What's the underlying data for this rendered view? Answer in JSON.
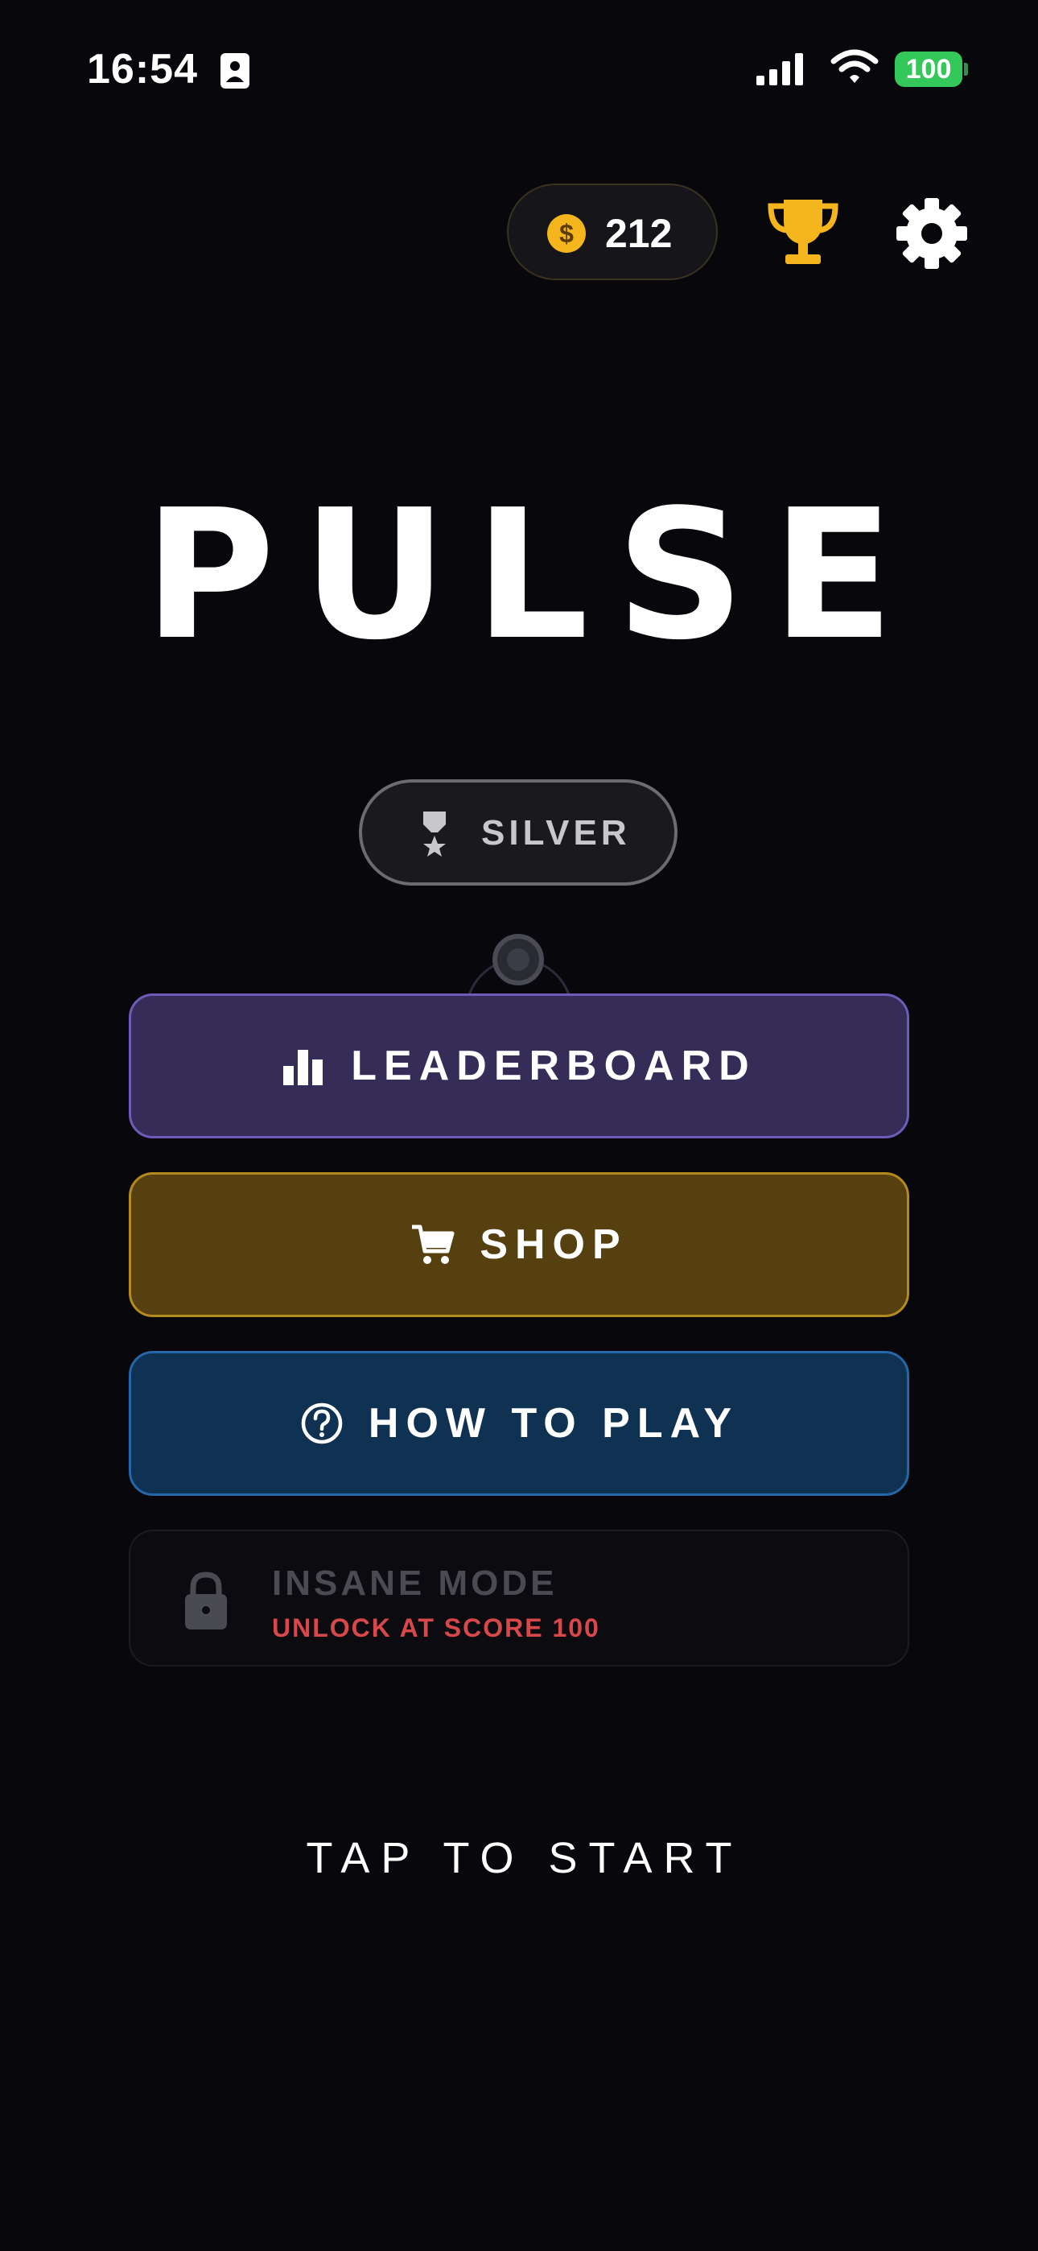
{
  "status_bar": {
    "time": "16:54",
    "battery": "100",
    "icons": [
      "contact-card-icon",
      "signal-icon",
      "wifi-icon",
      "battery-icon"
    ]
  },
  "top_bar": {
    "coins": "212",
    "coin_icon": "dollar-coin-icon",
    "trophy_icon": "trophy-icon",
    "settings_icon": "gear-icon"
  },
  "title": "PULSE",
  "rank": {
    "label": "SILVER",
    "icon": "medal-icon"
  },
  "menu": {
    "leaderboard": {
      "label": "LEADERBOARD",
      "icon": "bar-chart-icon"
    },
    "shop": {
      "label": "SHOP",
      "icon": "cart-icon"
    },
    "how_to_play": {
      "label": "HOW TO PLAY",
      "icon": "help-circle-icon"
    }
  },
  "locked_mode": {
    "title": "INSANE MODE",
    "subtitle": "UNLOCK AT SCORE 100",
    "icon": "lock-icon"
  },
  "start_prompt": "TAP TO START",
  "colors": {
    "background": "#07070c",
    "coin": "#f5b51c",
    "trophy": "#f5b51c",
    "leaderboard_bg": "#352c58",
    "leaderboard_border": "#6f5cb8",
    "shop_bg": "#56400f",
    "shop_border": "#b38a1e",
    "howto_bg": "#0f3152",
    "howto_border": "#2466a8",
    "locked_subtitle": "#d8484a",
    "battery": "#34c759"
  }
}
